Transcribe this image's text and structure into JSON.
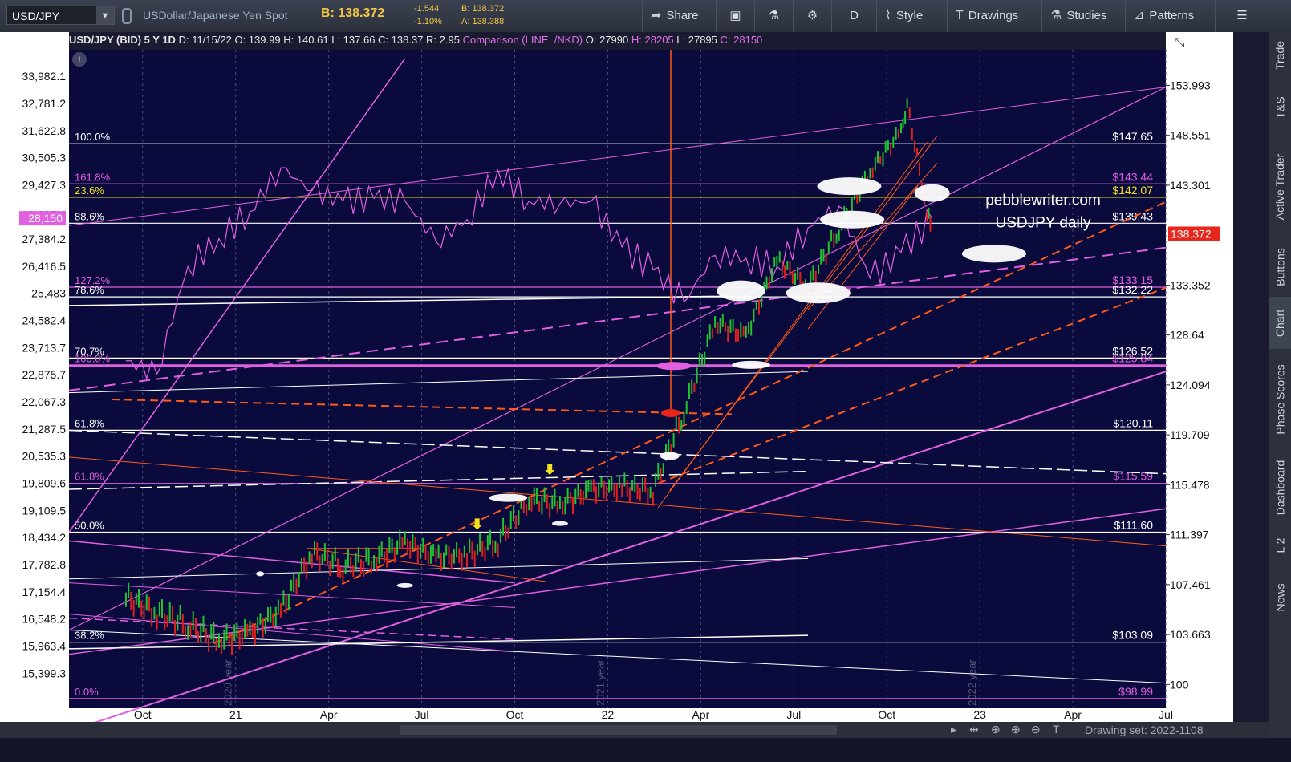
{
  "toolbar": {
    "symbol": "USD/JPY",
    "description": "USDollar/Japanese Yen Spot",
    "bid_label": "B: 138.372",
    "change_abs": "-1.544",
    "change_pct": "-1.10%",
    "bid_small": "B: 138.372",
    "ask_small": "A: 138.388",
    "share": "Share",
    "period": "D",
    "style": "Style",
    "drawings": "Drawings",
    "studies": "Studies",
    "patterns": "Patterns"
  },
  "side_tabs": [
    "Trade",
    "T&S",
    "Active Trader",
    "Buttons",
    "Chart",
    "Phase Scores",
    "Dashboard",
    "L 2",
    "News"
  ],
  "info_bar": {
    "title": "USD/JPY (BID) 5 Y 1D",
    "date": "D: 11/15/22",
    "open": "O: 139.99",
    "high": "H: 140.61",
    "low": "L: 137.66",
    "close": "C: 138.37",
    "range": "R: 2.95",
    "comparison": "Comparison (LINE, /NKD)",
    "cmp_open": "O: 27990",
    "cmp_high": "H: 28205",
    "cmp_low": "L: 27895",
    "cmp_close": "C: 28150"
  },
  "watermark": [
    "pebblewriter.com",
    "USDJPY daily"
  ],
  "bottom": {
    "drawing_set": "Drawing set: 2022-1108"
  },
  "colors": {
    "background": "#0a0a3c",
    "magenta": "#e060e0",
    "orange": "#ff5a1a",
    "white": "#ffffff",
    "yellow": "#f2e21e",
    "price_tag": "#e8261c",
    "up_candle": "#22c233",
    "down_candle": "#e02020"
  },
  "chart_data": {
    "type": "line",
    "title": "USD/JPY (BID) 5 Y 1D",
    "y_right_ticks": [
      "153.993",
      "148.551",
      "143.301",
      "138.372",
      "133.352",
      "128.64",
      "124.094",
      "119.709",
      "115.478",
      "111.397",
      "107.461",
      "103.663",
      "100"
    ],
    "y_left_ticks": [
      "33,982.1",
      "32,781.2",
      "31,622.8",
      "30,505.3",
      "29,427.3",
      "28,287.4",
      "27,384.2",
      "26,416.5",
      "25,483",
      "24,582.4",
      "23,713.7",
      "22,875.7",
      "22,067.3",
      "21,287.5",
      "20,535.3",
      "19,809.6",
      "19,109.5",
      "18,434.2",
      "17,782.8",
      "17,154.4",
      "16,548.2",
      "15,963.4",
      "15,399.3"
    ],
    "y_left_current": "28,150",
    "x_ticks": [
      "Oct",
      "21",
      "Apr",
      "Jul",
      "Oct",
      "22",
      "Apr",
      "Jul",
      "Oct",
      "23",
      "Apr",
      "Jul"
    ],
    "year_markers": [
      "2020 year",
      "2021 year",
      "2022 year"
    ],
    "current_price": "138.372",
    "fib_levels_left": [
      {
        "label": "100.0%",
        "color": "white"
      },
      {
        "label": "161.8%",
        "color": "magenta"
      },
      {
        "label": "23.6%",
        "color": "yellow"
      },
      {
        "label": "88.6%",
        "color": "white"
      },
      {
        "label": "127.2%",
        "color": "magenta"
      },
      {
        "label": "78.6%",
        "color": "white"
      },
      {
        "label": "70.7%",
        "color": "white"
      },
      {
        "label": "100.0%",
        "color": "magenta"
      },
      {
        "label": "61.8%",
        "color": "white"
      },
      {
        "label": "61.8%",
        "color": "magenta"
      },
      {
        "label": "50.0%",
        "color": "white"
      },
      {
        "label": "38.2%",
        "color": "white"
      },
      {
        "label": "0.0%",
        "color": "magenta"
      }
    ],
    "price_levels_right": [
      {
        "label": "$147.65",
        "value": 147.65,
        "color": "white"
      },
      {
        "label": "$143.44",
        "value": 143.44,
        "color": "magenta"
      },
      {
        "label": "$142.07",
        "value": 142.07,
        "color": "yellow"
      },
      {
        "label": "$139.43",
        "value": 139.43,
        "color": "white"
      },
      {
        "label": "$133.15",
        "value": 133.15,
        "color": "magenta"
      },
      {
        "label": "$132.22",
        "value": 132.22,
        "color": "white"
      },
      {
        "label": "$126.52",
        "value": 126.52,
        "color": "white"
      },
      {
        "label": "$125.84",
        "value": 125.84,
        "color": "magenta"
      },
      {
        "label": "$120.11",
        "value": 120.11,
        "color": "white"
      },
      {
        "label": "$115.59",
        "value": 115.59,
        "color": "magenta"
      },
      {
        "label": "$111.60",
        "value": 111.6,
        "color": "white"
      },
      {
        "label": "$103.09",
        "value": 103.09,
        "color": "white"
      },
      {
        "label": "$98.99",
        "value": 98.99,
        "color": "magenta"
      }
    ],
    "usdjpy_series": {
      "name": "USD/JPY",
      "points": [
        [
          "2020-09",
          106.5
        ],
        [
          "2020-10",
          105.3
        ],
        [
          "2020-11",
          104.4
        ],
        [
          "2020-12",
          103.2
        ],
        [
          "2021-01",
          103.8
        ],
        [
          "2021-02",
          105.5
        ],
        [
          "2021-03",
          109.9
        ],
        [
          "2021-04",
          108.9
        ],
        [
          "2021-05",
          109.4
        ],
        [
          "2021-06",
          110.8
        ],
        [
          "2021-07",
          109.6
        ],
        [
          "2021-08",
          109.8
        ],
        [
          "2021-09",
          110.9
        ],
        [
          "2021-10",
          114.3
        ],
        [
          "2021-11",
          113.8
        ],
        [
          "2021-12",
          115.1
        ],
        [
          "2022-01",
          115.3
        ],
        [
          "2022-02",
          115.0
        ],
        [
          "2022-03",
          121.7
        ],
        [
          "2022-04",
          129.8
        ],
        [
          "2022-05",
          128.6
        ],
        [
          "2022-06",
          135.7
        ],
        [
          "2022-07",
          133.2
        ],
        [
          "2022-08",
          138.9
        ],
        [
          "2022-09",
          144.7
        ],
        [
          "2022-10",
          149.0
        ],
        [
          "2022-10-21",
          151.9
        ],
        [
          "2022-11-10",
          140.6
        ],
        [
          "2022-11-15",
          138.37
        ]
      ]
    },
    "nkd_series": {
      "name": "/NKD",
      "points": [
        [
          "2020-09",
          23300
        ],
        [
          "2020-10",
          22900
        ],
        [
          "2020-11",
          26400
        ],
        [
          "2020-12",
          27400
        ],
        [
          "2021-01",
          28400
        ],
        [
          "2021-02",
          30100
        ],
        [
          "2021-03",
          29200
        ],
        [
          "2021-04",
          28800
        ],
        [
          "2021-05",
          28900
        ],
        [
          "2021-06",
          28800
        ],
        [
          "2021-07",
          27300
        ],
        [
          "2021-08",
          28100
        ],
        [
          "2021-09",
          30000
        ],
        [
          "2021-10",
          28800
        ],
        [
          "2021-11",
          28700
        ],
        [
          "2021-12",
          28800
        ],
        [
          "2022-01",
          27100
        ],
        [
          "2022-02",
          26300
        ],
        [
          "2022-03",
          25200
        ],
        [
          "2022-04",
          26800
        ],
        [
          "2022-05",
          26700
        ],
        [
          "2022-06",
          26400
        ],
        [
          "2022-07",
          27800
        ],
        [
          "2022-08",
          28600
        ],
        [
          "2022-09",
          26000
        ],
        [
          "2022-10",
          26900
        ],
        [
          "2022-11",
          28150
        ]
      ]
    }
  }
}
